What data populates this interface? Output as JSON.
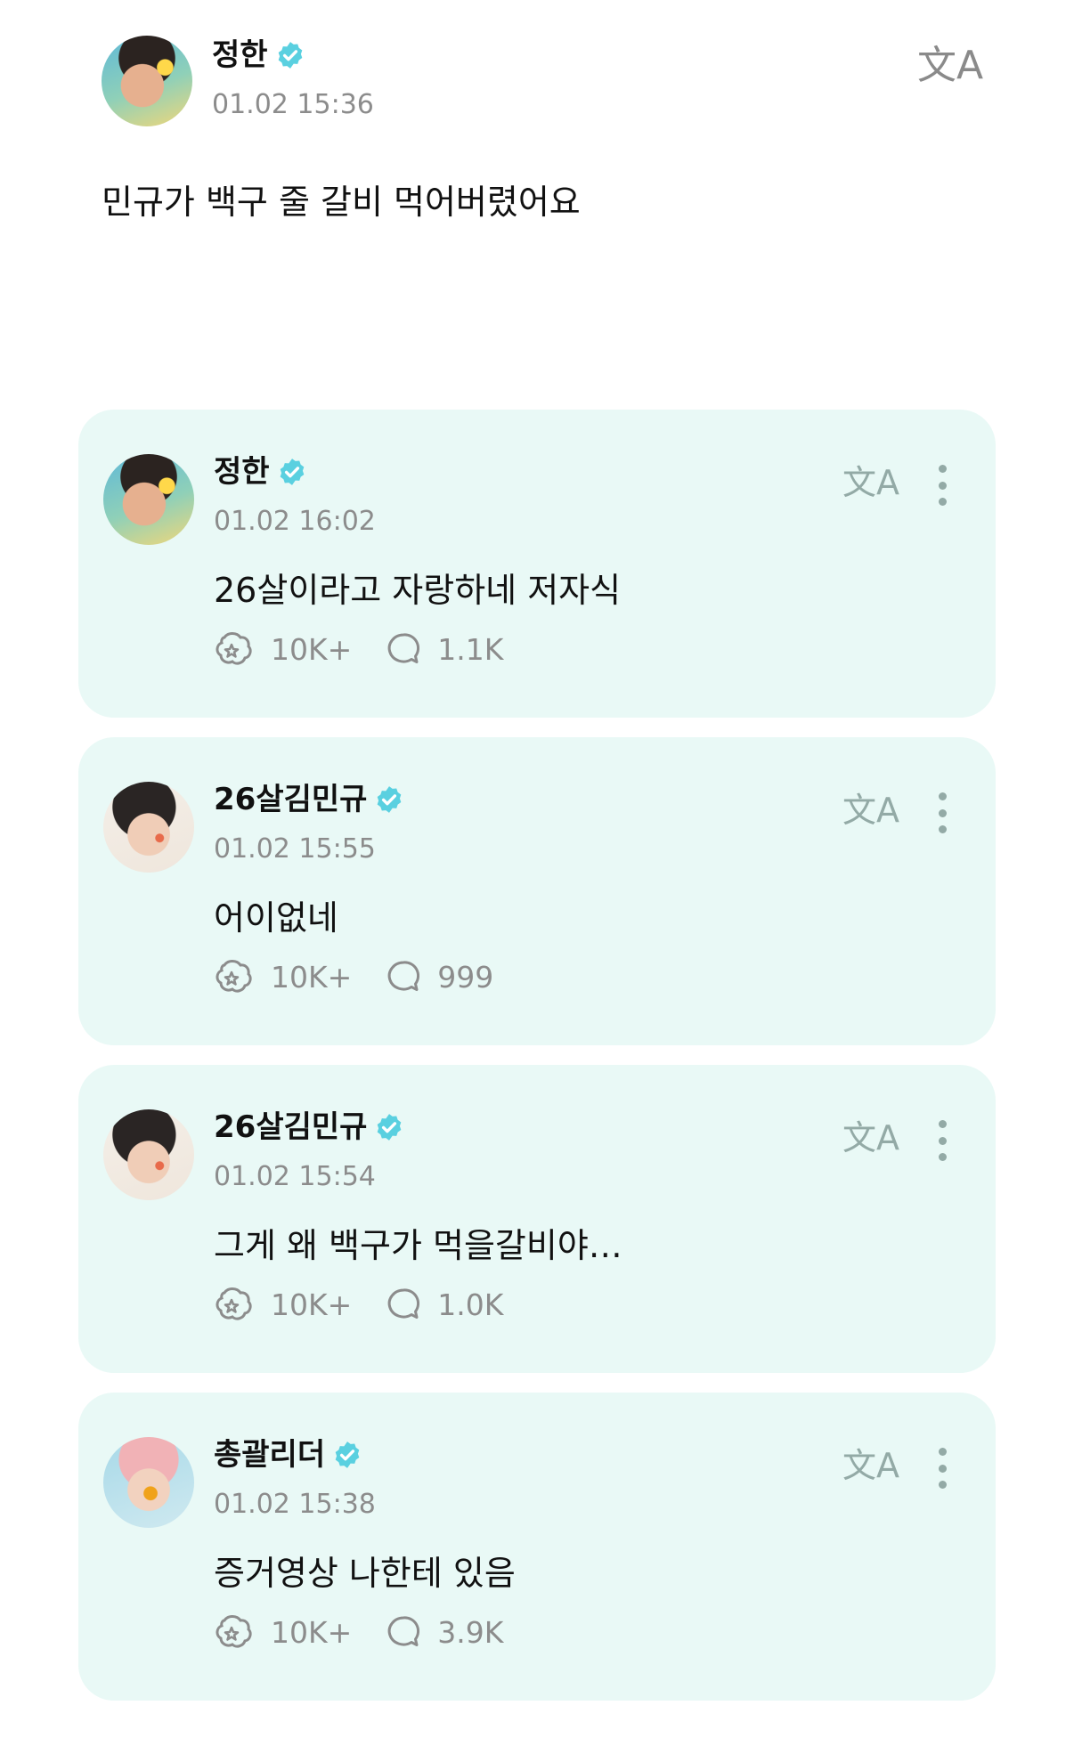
{
  "colors": {
    "accent": "#5ad0e0",
    "card_bg": "#e9f9f6",
    "muted": "#8c8c8c"
  },
  "post": {
    "author": "정한",
    "time": "01.02 15:36",
    "body": "민규가 백구 줄 갈비 먹어버렸어요",
    "translate_icon": "文A"
  },
  "comments": [
    {
      "author": "정한",
      "time": "01.02 16:02",
      "text": "26살이라고 자랑하네 저자식",
      "likes": "10K+",
      "replies": "1.1K",
      "translate_icon": "文A",
      "avatar": "jeonghan"
    },
    {
      "author": "26살김민규",
      "time": "01.02 15:55",
      "text": "어이없네",
      "likes": "10K+",
      "replies": "999",
      "translate_icon": "文A",
      "avatar": "mingyu"
    },
    {
      "author": "26살김민규",
      "time": "01.02 15:54",
      "text": "그게 왜 백구가 먹을갈비야…",
      "likes": "10K+",
      "replies": "1.0K",
      "translate_icon": "文A",
      "avatar": "mingyu"
    },
    {
      "author": "총괄리더",
      "time": "01.02 15:38",
      "text": "증거영상 나한테 있음",
      "likes": "10K+",
      "replies": "3.9K",
      "translate_icon": "文A",
      "avatar": "leader"
    }
  ]
}
